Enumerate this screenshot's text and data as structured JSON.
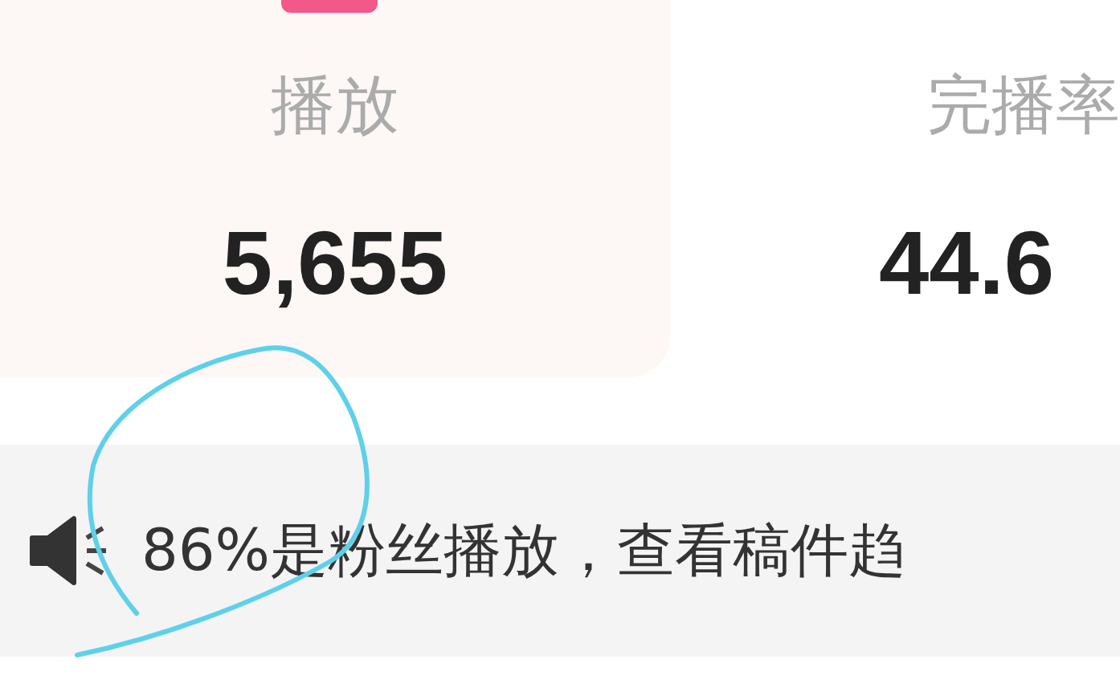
{
  "stats": [
    {
      "label": "播放",
      "value": "5,655",
      "selected": true
    },
    {
      "label": "完播率",
      "value": "44.6",
      "selected": false
    }
  ],
  "notice": {
    "text": "86%是粉丝播放，查看稿件趋"
  }
}
